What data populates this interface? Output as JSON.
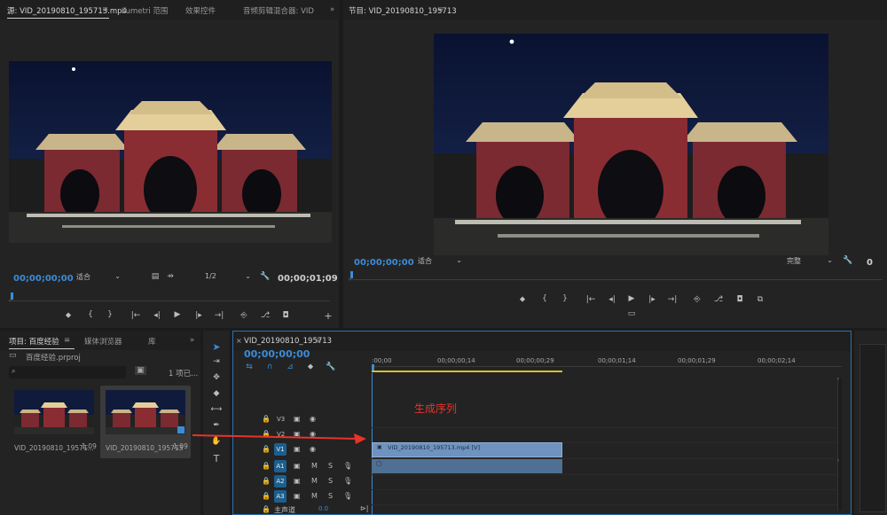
{
  "source_monitor": {
    "tabs": [
      "源: VID_20190810_195713.mp4",
      "≡",
      "Lumetri 范围",
      "效果控件",
      "音频剪辑混合器: VID",
      "»"
    ],
    "timecode": "00;00;00;00",
    "fit": "适合",
    "resolution": "1/2",
    "duration": "00;00;01;09",
    "playhead_fraction": 0.0
  },
  "program_monitor": {
    "tab": "节目: VID_20190810_195713",
    "menu": "≡",
    "timecode": "00;00;00;00",
    "fit": "适合",
    "quality": "完整",
    "playhead_fraction": 0.0
  },
  "project": {
    "tabs": [
      "项目: 百度经验",
      "≡",
      "媒体浏览器",
      "库",
      "»"
    ],
    "file": "百度经验.prproj",
    "count": "1 项已...",
    "items": [
      {
        "name": "VID_20190810_19571...",
        "duration": "1;09"
      },
      {
        "name": "VID_20190810_195713",
        "duration": "1;09"
      }
    ]
  },
  "timeline": {
    "tab": "VID_20190810_195713",
    "menu": "≡",
    "timecode": "00;00;00;00",
    "ruler": [
      ":00;00",
      "00;00;00;14",
      "00;00;00;29",
      "00;00;01;14",
      "00;00;01;29",
      "00;00;02;14"
    ],
    "video_tracks": [
      "V3",
      "V2",
      "V1"
    ],
    "audio_tracks": [
      "A1",
      "A2",
      "A3"
    ],
    "master": "主声道",
    "master_value": "0.0",
    "clip_label": "VID_20190810_195713.mp4 [V]",
    "annotation": "生成序列",
    "clip_end_fraction": 0.41
  },
  "colors": {
    "accent": "#3c8bd8",
    "clip": "#6f93c0",
    "annotation": "#e8332a",
    "track_button": "#1b5f8f",
    "work_area": "#d9c02a"
  }
}
